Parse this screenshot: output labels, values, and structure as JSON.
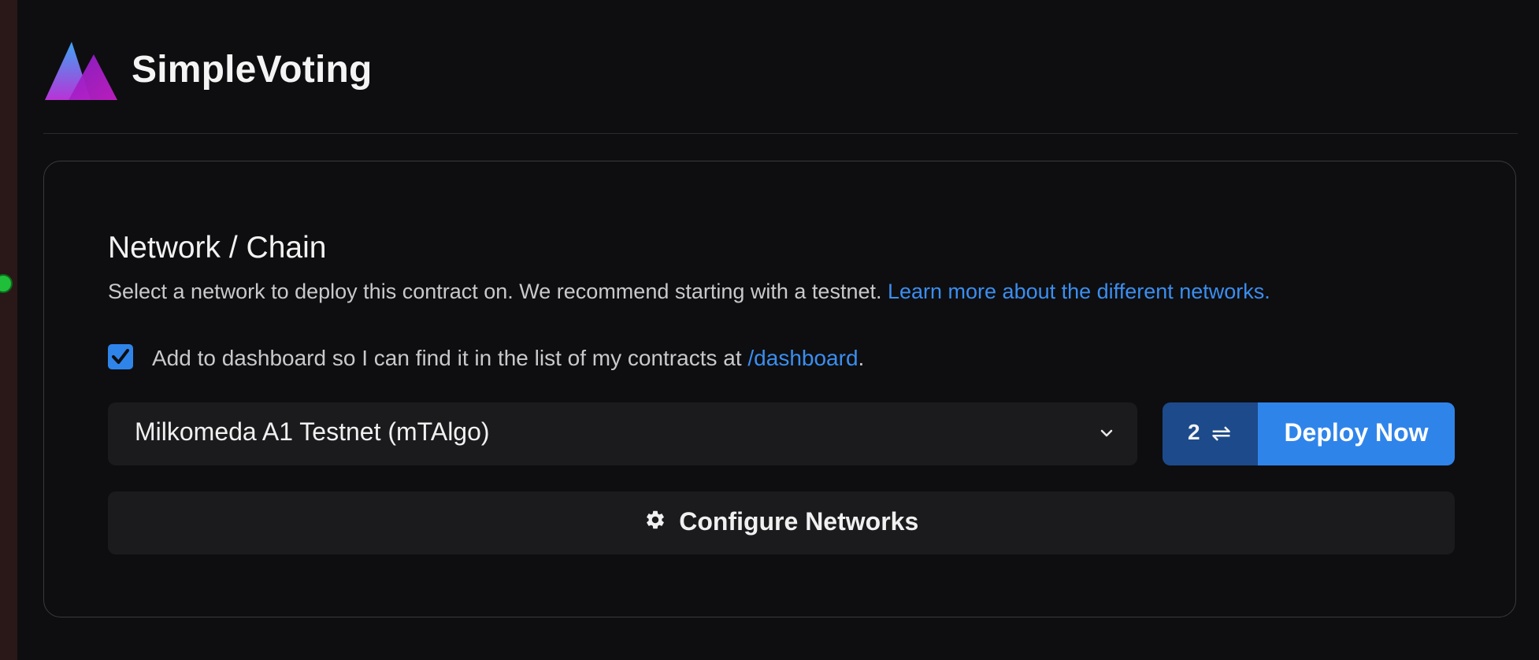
{
  "app": {
    "title": "SimpleVoting"
  },
  "network_section": {
    "title": "Network / Chain",
    "description": "Select a network to deploy this contract on. We recommend starting with a testnet. ",
    "learn_more_link": "Learn more about the different networks."
  },
  "dashboard_option": {
    "checked": true,
    "label_prefix": "Add to dashboard so I can find it in the list of my contracts at ",
    "link_text": "/dashboard",
    "label_suffix": "."
  },
  "network_select": {
    "selected": "Milkomeda A1 Testnet (mTAlgo)",
    "icon": "chevron-down-icon"
  },
  "deploy": {
    "queue_count": "2",
    "queue_icon": "⇌",
    "label": "Deploy Now"
  },
  "configure": {
    "label": "Configure Networks",
    "icon": "gear-icon"
  },
  "colors": {
    "background": "#0e0e10",
    "accent": "#2f84ea",
    "accent_dark": "#1d4a8a",
    "link": "#3b8ef0",
    "surface": "#1b1b1e"
  }
}
